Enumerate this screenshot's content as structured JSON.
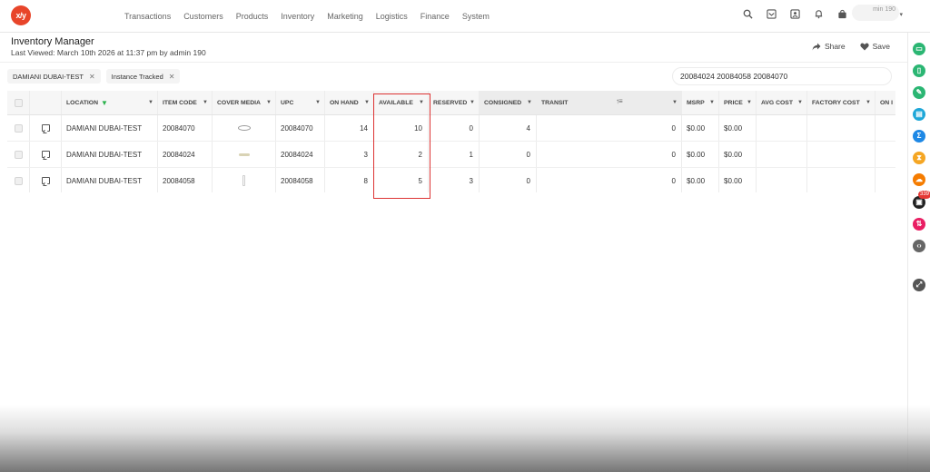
{
  "nav": {
    "logo": "x/y",
    "menu": [
      "Transactions",
      "Customers",
      "Products",
      "Inventory",
      "Marketing",
      "Logistics",
      "Finance",
      "System"
    ],
    "user": "min 190"
  },
  "header": {
    "title": "Inventory Manager",
    "subtitle": "Last Viewed: March 10th 2026 at 11:37 pm by admin 190",
    "share_label": "Share",
    "save_label": "Save"
  },
  "filters": {
    "chips": [
      "DAMIANI DUBAI-TEST",
      "Instance Tracked"
    ],
    "search_value": "20084024 20084058 20084070"
  },
  "table": {
    "columns": [
      "LOCATION",
      "ITEM CODE",
      "COVER MEDIA",
      "UPC",
      "ON HAND",
      "AVAILABLE",
      "RESERVED",
      "CONSIGNED",
      "TRANSIT",
      "MSRP",
      "PRICE",
      "AVG COST",
      "FACTORY COST",
      "ON I"
    ],
    "rows": [
      {
        "location": "DAMIANI DUBAI-TEST",
        "item_code": "20084070",
        "upc": "20084070",
        "on_hand": "14",
        "available": "10",
        "reserved": "0",
        "consigned": "4",
        "transit": "0",
        "msrp": "$0.00",
        "price": "$0.00"
      },
      {
        "location": "DAMIANI DUBAI-TEST",
        "item_code": "20084024",
        "upc": "20084024",
        "on_hand": "3",
        "available": "2",
        "reserved": "1",
        "consigned": "0",
        "transit": "0",
        "msrp": "$0.00",
        "price": "$0.00"
      },
      {
        "location": "DAMIANI DUBAI-TEST",
        "item_code": "20084058",
        "upc": "20084058",
        "on_hand": "8",
        "available": "5",
        "reserved": "3",
        "consigned": "0",
        "transit": "0",
        "msrp": "$0.00",
        "price": "$0.00"
      }
    ]
  },
  "rail": {
    "badge": "339",
    "colors": [
      "#2bb673",
      "#2bb673",
      "#2bb673",
      "#1ea7d8",
      "#1e88e5",
      "#f5a623",
      "#f57c00",
      "#222222",
      "#e91e63",
      "#666666",
      "#555555"
    ]
  }
}
